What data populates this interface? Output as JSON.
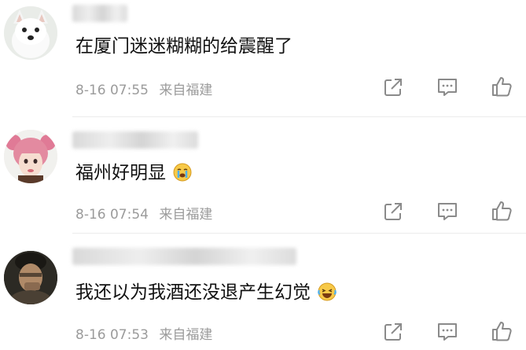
{
  "comments": [
    {
      "username": "",
      "text": "在厦门迷迷糊糊的给震醒了",
      "date": "8-16 07:55",
      "location": "来自福建",
      "avatar": "white-dog-avatar",
      "emoji": ""
    },
    {
      "username": "",
      "text": "福州好明显",
      "date": "8-16 07:54",
      "location": "来自福建",
      "avatar": "pink-hair-girl-avatar",
      "emoji": "crying-face-emoji"
    },
    {
      "username": "",
      "text": "我还以为我酒还没退产生幻觉",
      "date": "8-16 07:53",
      "location": "来自福建",
      "avatar": "man-portrait-avatar",
      "emoji": "laughing-crying-emoji"
    }
  ],
  "colors": {
    "text": "#111111",
    "meta": "#9b9b9b",
    "icon": "#8a8a8a"
  },
  "icons": [
    "share-icon",
    "comment-icon",
    "like-icon"
  ]
}
